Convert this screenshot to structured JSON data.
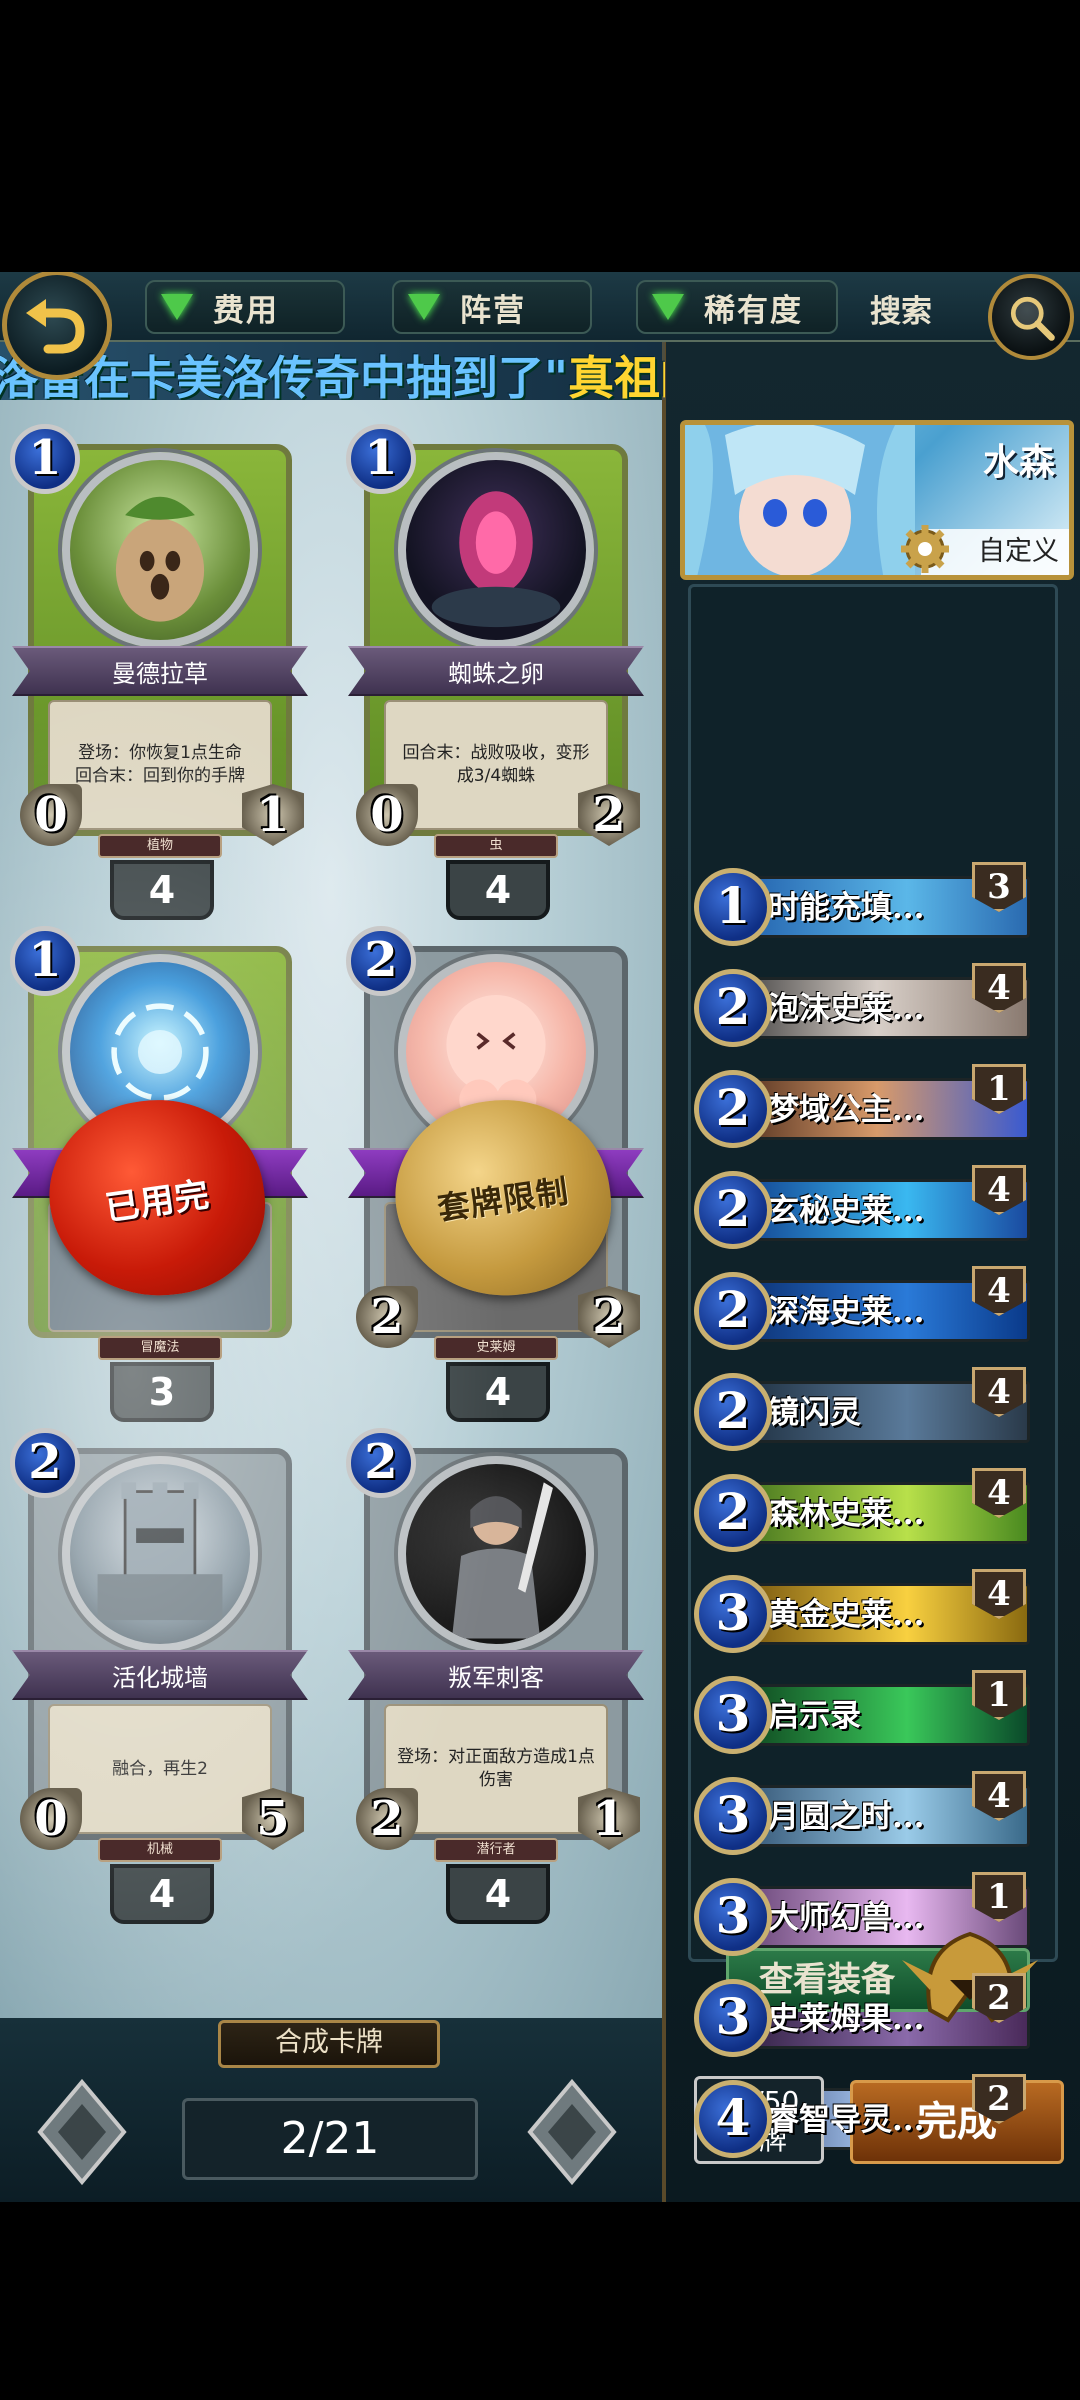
{
  "filters": [
    {
      "label": "费用",
      "icon": "triangle-down-icon"
    },
    {
      "label": "阵营",
      "icon": "triangle-down-icon"
    },
    {
      "label": "稀有度",
      "icon": "triangle-down-icon"
    }
  ],
  "search_label": "搜索",
  "ticker": {
    "prefix": "洛雷在卡美洛传奇中抽到了\"",
    "highlight": "真祖的盛宴",
    "suffix": "\"!"
  },
  "cards": [
    {
      "cost": "1",
      "name": "曼德拉草",
      "desc": "登场：你恢复1点生命\n回合末：回到你的手牌",
      "attack": "0",
      "health": "1",
      "tribe": "植物",
      "count": "4"
    },
    {
      "cost": "1",
      "name": "蜘蛛之卵",
      "desc": "回合末：战败吸收，变形成3/4蜘蛛",
      "attack": "0",
      "health": "2",
      "tribe": "虫",
      "count": "4"
    },
    {
      "cost": "1",
      "name": "",
      "desc": "",
      "attack": "",
      "health": "",
      "tribe": "冒魔法",
      "count": "3",
      "seal": "已用完"
    },
    {
      "cost": "2",
      "name": "",
      "desc": "",
      "attack": "2",
      "health": "2",
      "tribe": "史莱姆",
      "count": "4",
      "seal": "套牌限制"
    },
    {
      "cost": "2",
      "name": "活化城墙",
      "desc": "融合，再生2",
      "attack": "0",
      "health": "5",
      "tribe": "机械",
      "count": "4"
    },
    {
      "cost": "2",
      "name": "叛军刺客",
      "desc": "登场：对正面敌方造成1点伤害",
      "attack": "2",
      "health": "1",
      "tribe": "潜行者",
      "count": "4"
    }
  ],
  "synth_label": "合成卡牌",
  "page": "2/21",
  "deck": {
    "name": "水森",
    "custom_label": "自定义",
    "items": [
      {
        "cost": "1",
        "name": "时能充填...",
        "qty": "3"
      },
      {
        "cost": "2",
        "name": "泡沫史莱...",
        "qty": "4"
      },
      {
        "cost": "2",
        "name": "梦域公主...",
        "qty": "1"
      },
      {
        "cost": "2",
        "name": "玄秘史莱...",
        "qty": "4"
      },
      {
        "cost": "2",
        "name": "深海史莱...",
        "qty": "4"
      },
      {
        "cost": "2",
        "name": "镜闪灵",
        "qty": "4"
      },
      {
        "cost": "2",
        "name": "森林史莱...",
        "qty": "4"
      },
      {
        "cost": "3",
        "name": "黄金史莱...",
        "qty": "4"
      },
      {
        "cost": "3",
        "name": "启示录",
        "qty": "1"
      },
      {
        "cost": "3",
        "name": "月圆之时...",
        "qty": "4"
      },
      {
        "cost": "3",
        "name": "大师幻兽...",
        "qty": "1"
      },
      {
        "cost": "3",
        "name": "史莱姆果...",
        "qty": "2"
      },
      {
        "cost": "4",
        "name": "睿智导灵...",
        "qty": "2"
      }
    ],
    "view_equip_label": "查看装备",
    "count_line1": "50/50",
    "count_line2": "卡牌",
    "done_label": "完成"
  },
  "colors": {
    "accent_gold": "#b08a3a",
    "filter_arrow": "#4ec94a",
    "cost_blue": "#2a5bc4",
    "done_orange": "#b86a22"
  }
}
